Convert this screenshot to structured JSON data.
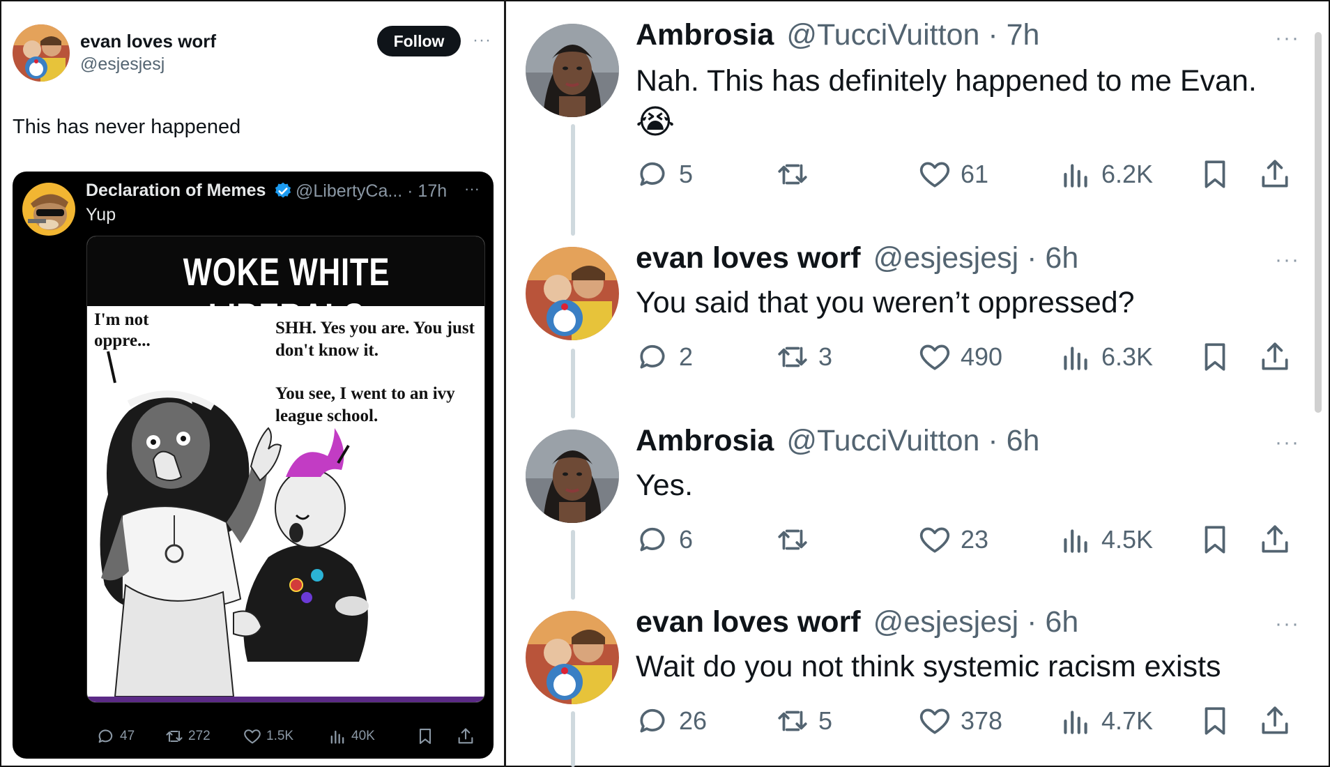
{
  "left_tweet": {
    "author_name": "evan loves worf",
    "author_handle": "@esjesjesj",
    "follow_label": "Follow",
    "more": "···",
    "text": "This has never happened",
    "quoted": {
      "author_name": "Declaration of Memes",
      "author_handle": "@LibertyCa... · 17h",
      "more": "···",
      "text": "Yup",
      "meme": {
        "title": "WOKE WHITE LIBERALS",
        "speech_left": "I'm not oppre...",
        "speech_right_1": "SHH. Yes you are. You just don't know it.",
        "speech_right_2": "You see, I went to an ivy league school."
      },
      "stats": {
        "replies": "47",
        "retweets": "272",
        "likes": "1.5K",
        "views": "40K"
      }
    }
  },
  "thread": [
    {
      "name": "Ambrosia",
      "handle": "@TucciVuitton · 7h",
      "text": "Nah. This has definitely happened to me Evan.",
      "emoji": "😭",
      "replies": "5",
      "retweets": "",
      "likes": "61",
      "views": "6.2K"
    },
    {
      "name": "evan loves worf",
      "handle": "@esjesjesj · 6h",
      "text": "You said that you weren’t oppressed?",
      "replies": "2",
      "retweets": "3",
      "likes": "490",
      "views": "6.3K"
    },
    {
      "name": "Ambrosia",
      "handle": "@TucciVuitton · 6h",
      "text": "Yes.",
      "replies": "6",
      "retweets": "",
      "likes": "23",
      "views": "4.5K"
    },
    {
      "name": "evan loves worf",
      "handle": "@esjesjesj · 6h",
      "text": "Wait do you not think systemic racism exists",
      "replies": "26",
      "retweets": "5",
      "likes": "378",
      "views": "4.7K"
    }
  ],
  "more_label": "···",
  "colors": {
    "text_primary": "#0f1419",
    "text_secondary": "#536471",
    "thread_line": "#cfd9de",
    "verified_blue": "#1d9bf0"
  }
}
